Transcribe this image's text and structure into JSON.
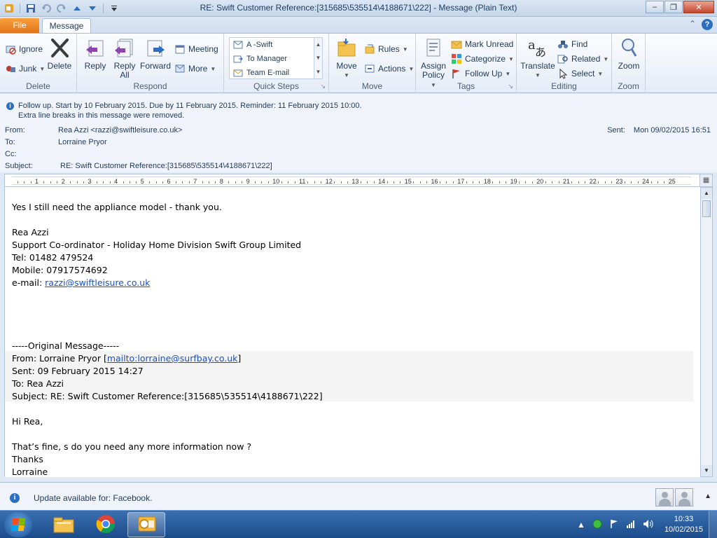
{
  "window": {
    "title": "RE: Swift Customer Reference:[315685\\535514\\4188671\\222]  -  Message (Plain Text)"
  },
  "tabs": {
    "file": "File",
    "message": "Message"
  },
  "ribbon": {
    "delete_group": {
      "label": "Delete",
      "ignore": "Ignore",
      "junk": "Junk",
      "delete": "Delete"
    },
    "respond_group": {
      "label": "Respond",
      "reply": "Reply",
      "reply_all_1": "Reply",
      "reply_all_2": "All",
      "forward": "Forward",
      "meeting": "Meeting",
      "more": "More"
    },
    "quick_steps_group": {
      "label": "Quick Steps",
      "items": [
        "A -Swift",
        "To Manager",
        "Team E-mail"
      ]
    },
    "move_group": {
      "label": "Move",
      "move": "Move",
      "rules": "Rules",
      "actions": "Actions"
    },
    "tags_group": {
      "label": "Tags",
      "assign_policy_1": "Assign",
      "assign_policy_2": "Policy",
      "mark_unread": "Mark Unread",
      "categorize": "Categorize",
      "follow_up": "Follow Up"
    },
    "editing_group": {
      "label": "Editing",
      "translate": "Translate",
      "find": "Find",
      "related": "Related",
      "select": "Select"
    },
    "zoom_group": {
      "label": "Zoom",
      "zoom": "Zoom"
    }
  },
  "info": {
    "line1": "Follow up.  Start by 10 February 2015.  Due by 11 February 2015.  Reminder: 11 February 2015 10:00.",
    "line2": "Extra line breaks in this message were removed."
  },
  "header": {
    "from_label": "From:",
    "from_value": "Rea Azzi <razzi@swiftleisure.co.uk>",
    "to_label": "To:",
    "to_value": "Lorraine Pryor",
    "cc_label": "Cc:",
    "cc_value": "",
    "subject_label": "Subject:",
    "subject_value": "RE: Swift Customer Reference:[315685\\535514\\4188671\\222]",
    "sent_label": "Sent:",
    "sent_value": "Mon 09/02/2015 16:51"
  },
  "ruler": {
    "numbers": [
      "1",
      "2",
      "3",
      "4",
      "5",
      "6",
      "7",
      "8",
      "9",
      "10",
      "11",
      "12",
      "13",
      "14",
      "15",
      "16",
      "17",
      "18",
      "19",
      "20",
      "21",
      "22",
      "23",
      "24",
      "25"
    ]
  },
  "body": {
    "l1": "Yes I still need the appliance model - thank you.",
    "l2": "Rea Azzi",
    "l3": "Support Co-ordinator - Holiday Home Division Swift Group Limited",
    "l4": "Tel: 01482 479524",
    "l5": "Mobile: 07917574692",
    "l6_prefix": "e-mail: ",
    "l6_link": "razzi@swiftleisure.co.uk",
    "l7": "-----Original Message-----",
    "l8_prefix": "From: Lorraine Pryor [",
    "l8_link": "mailto:lorraine@surfbay.co.uk",
    "l8_suffix": "]",
    "l9": "Sent: 09 February 2015 14:27",
    "l10": "To: Rea Azzi",
    "l11": "Subject: RE: Swift Customer Reference:[315685\\535514\\4188671\\222]",
    "l12": "Hi Rea,",
    "l13": "That’s fine, s do you need any more information now ?",
    "l14": "Thanks",
    "l15": "Lorraine"
  },
  "people_pane": {
    "text": "Update available for: Facebook."
  },
  "taskbar": {
    "time": "10:33",
    "date": "10/02/2015"
  },
  "colors": {
    "file_tab": "#e0721b",
    "link": "#1a4fc7",
    "taskbar": "#1b4b8a"
  }
}
